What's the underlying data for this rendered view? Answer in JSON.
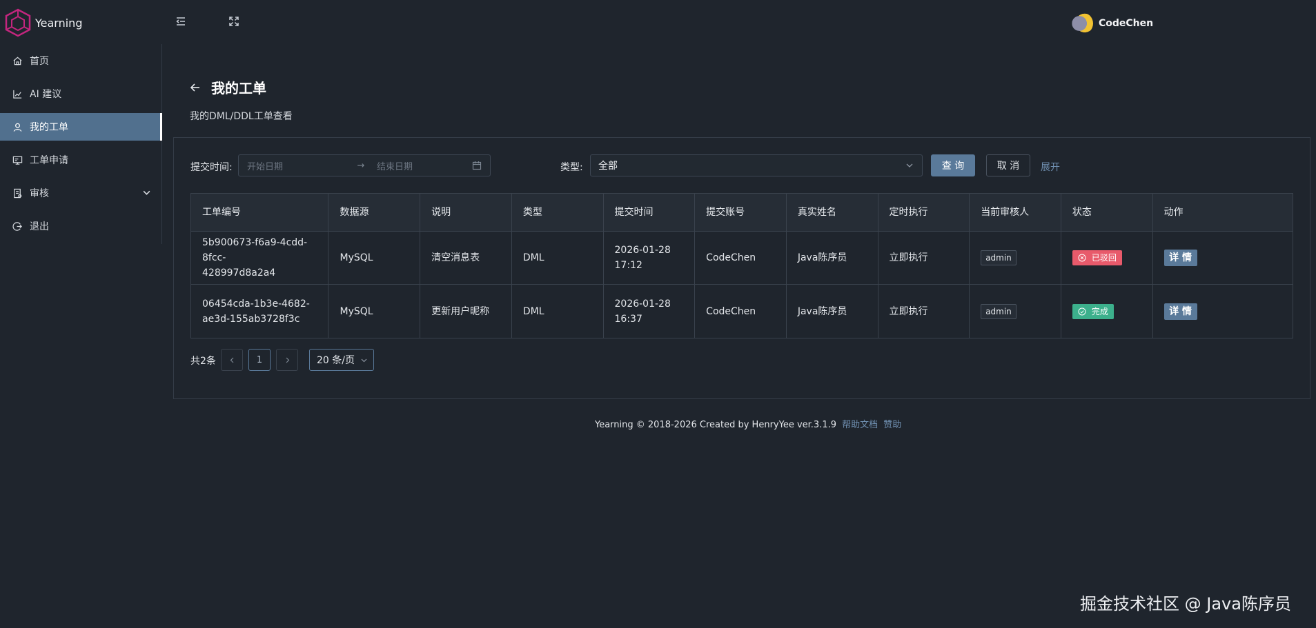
{
  "app": {
    "name": "Yearning"
  },
  "user": {
    "name": "CodeChen"
  },
  "sidebar": {
    "items": [
      {
        "label": "首页",
        "icon": "home-icon"
      },
      {
        "label": "AI 建议",
        "icon": "chart-icon"
      },
      {
        "label": "我的工单",
        "icon": "user-icon",
        "active": true
      },
      {
        "label": "工单申请",
        "icon": "monitor-icon"
      },
      {
        "label": "审核",
        "icon": "audit-icon",
        "expandable": true
      },
      {
        "label": "退出",
        "icon": "logout-icon"
      }
    ]
  },
  "page": {
    "title": "我的工单",
    "subtitle": "我的DML/DDL工单查看"
  },
  "filters": {
    "time_label": "提交时间:",
    "start_placeholder": "开始日期",
    "end_placeholder": "结束日期",
    "range_separator": "→",
    "type_label": "类型:",
    "type_value": "全部",
    "query_label": "查 询",
    "cancel_label": "取 消",
    "expand_label": "展开"
  },
  "table": {
    "columns": [
      "工单编号",
      "数据源",
      "说明",
      "类型",
      "提交时间",
      "提交账号",
      "真实姓名",
      "定时执行",
      "当前审核人",
      "状态",
      "动作"
    ],
    "rows": [
      {
        "id_line1": "5b900673-f6a9-4cdd-8fcc-",
        "id_line2": "428997d8a2a4",
        "source": "MySQL",
        "desc": "清空消息表",
        "type": "DML",
        "time_line1": "2026-01-28",
        "time_line2": "17:12",
        "account": "CodeChen",
        "real_name": "Java陈序员",
        "schedule": "立即执行",
        "reviewer": "admin",
        "status": "已驳回",
        "status_color": "#e85a6b",
        "action": "详 情"
      },
      {
        "id_line1": "06454cda-1b3e-4682-",
        "id_line2": "ae3d-155ab3728f3c",
        "source": "MySQL",
        "desc": "更新用户昵称",
        "type": "DML",
        "time_line1": "2026-01-28",
        "time_line2": "16:37",
        "account": "CodeChen",
        "real_name": "Java陈序员",
        "schedule": "立即执行",
        "reviewer": "admin",
        "status": "完成",
        "status_color": "#3cb08c",
        "action": "详 情"
      }
    ]
  },
  "pagination": {
    "total": "共2条",
    "current_page": "1",
    "page_size": "20 条/页"
  },
  "footer": {
    "text": "Yearning © 2018-2026 Created by HenryYee ver.3.1.9",
    "help_link": "帮助文档",
    "sponsor_link": "赞助"
  },
  "watermark": "掘金技术社区 @ Java陈序员"
}
